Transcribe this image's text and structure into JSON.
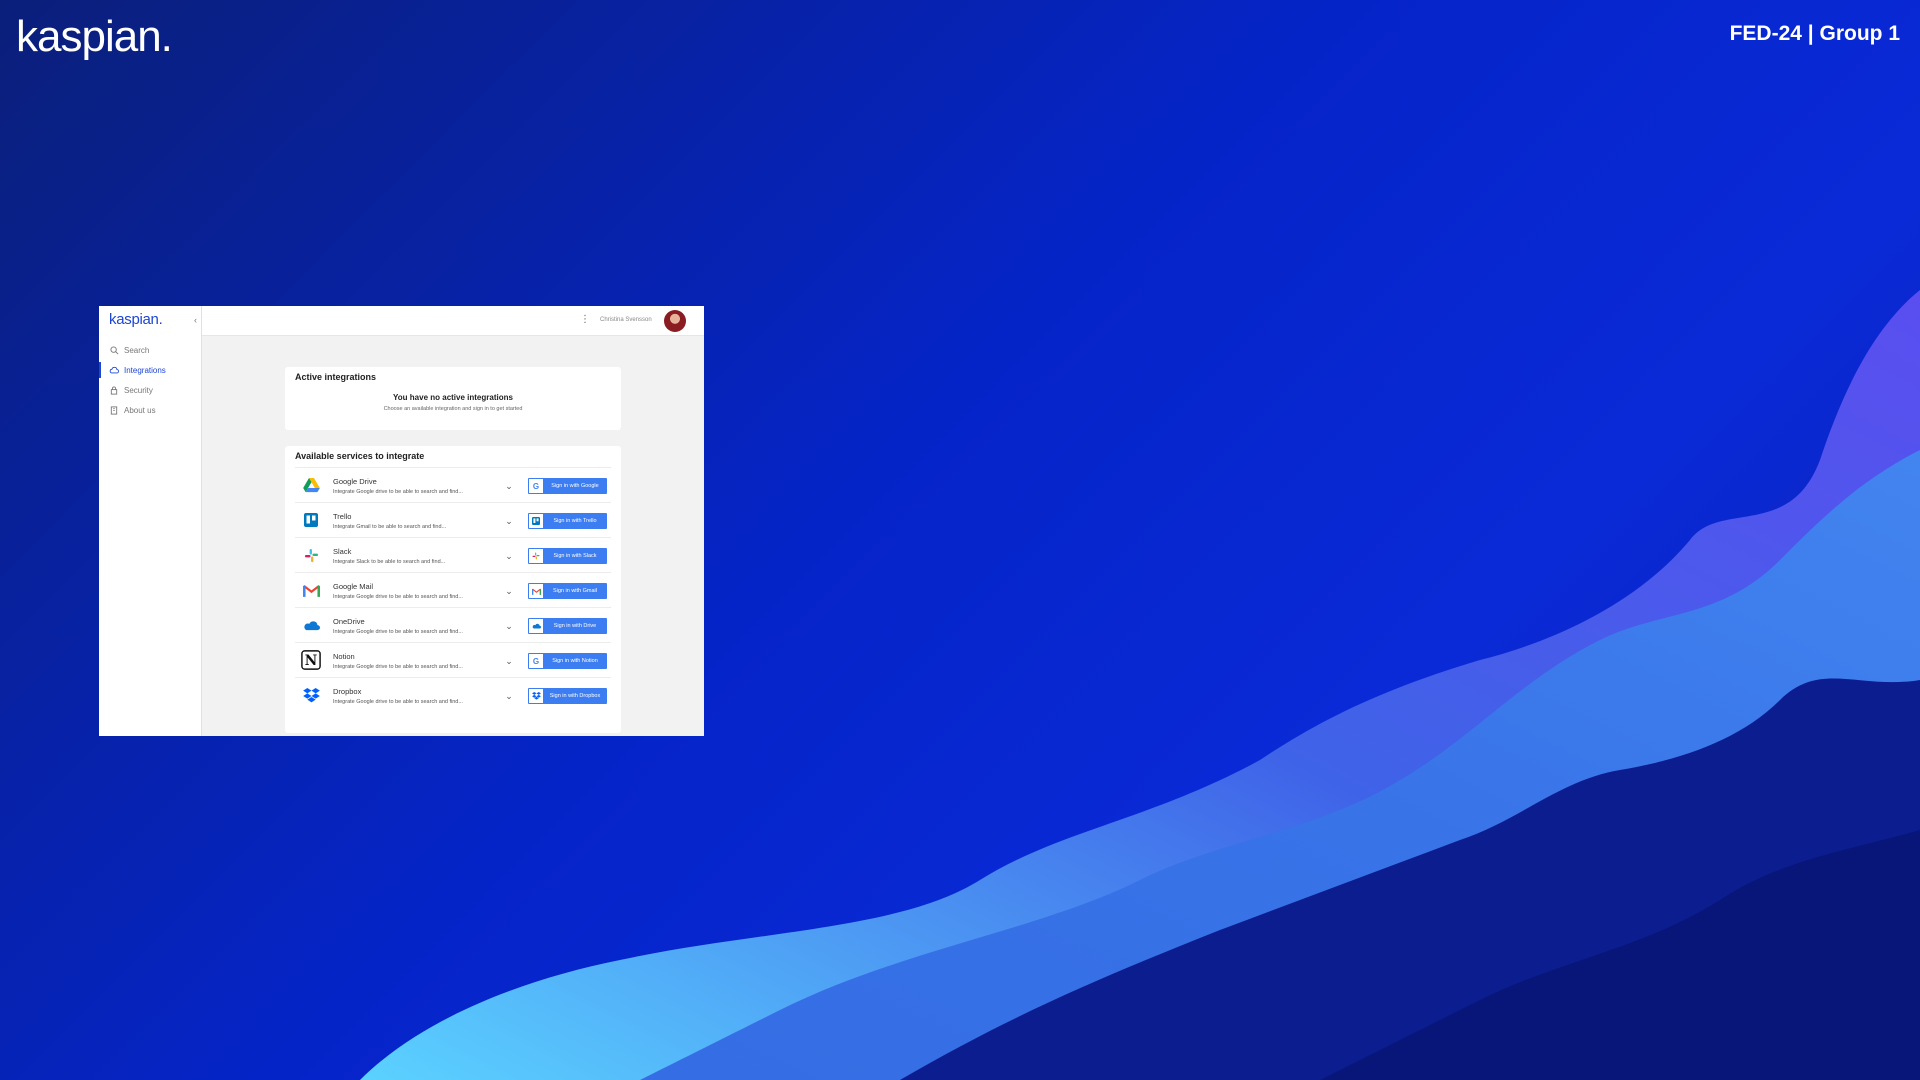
{
  "brand": {
    "logo": "kaspian.",
    "deck_label": "FED-24 | Group 1"
  },
  "app": {
    "logo": "kaspian.",
    "collapse_icon": "chevron-left-icon",
    "nav": [
      {
        "label": "Search",
        "icon": "search-icon",
        "active": false
      },
      {
        "label": "Integrations",
        "icon": "cloud-icon",
        "active": true
      },
      {
        "label": "Security",
        "icon": "lock-icon",
        "active": false
      },
      {
        "label": "About us",
        "icon": "building-icon",
        "active": false
      }
    ],
    "header": {
      "menu_icon": "kebab-menu-icon",
      "user_name": "Christina Svensson"
    },
    "active_integrations": {
      "title": "Active integrations",
      "empty_title": "You have no active integrations",
      "empty_subtitle": "Choose an available integration and sign in to get started"
    },
    "available": {
      "title": "Available services to integrate",
      "services": [
        {
          "name": "Google Drive",
          "desc": "Integrate Google drive to be able to search and find...",
          "button": "Sign in with Google",
          "icon": "google-drive-icon"
        },
        {
          "name": "Trello",
          "desc": "Integrate Gmail to be able to search and find...",
          "button": "Sign in with Trello",
          "icon": "trello-icon"
        },
        {
          "name": "Slack",
          "desc": "Integrate Slack to be able to search and find...",
          "button": "Sign in with Slack",
          "icon": "slack-icon"
        },
        {
          "name": "Google Mail",
          "desc": "Integrate Google drive to be able to search and find...",
          "button": "Sign in with Gmail",
          "icon": "gmail-icon"
        },
        {
          "name": "OneDrive",
          "desc": "Integrate Google drive to be able to search and find...",
          "button": "Sign in with Drive",
          "icon": "onedrive-icon"
        },
        {
          "name": "Notion",
          "desc": "Integrate Google drive to be able to search and find...",
          "button": "Sign in with Notion",
          "icon": "notion-icon"
        },
        {
          "name": "Dropbox",
          "desc": "Integrate Google drive to be able to search and find...",
          "button": "Sign in with Dropbox",
          "icon": "dropbox-icon"
        }
      ]
    }
  },
  "colors": {
    "accent": "#1c45d6",
    "button": "#3d7df2",
    "background": "#0524c8"
  }
}
